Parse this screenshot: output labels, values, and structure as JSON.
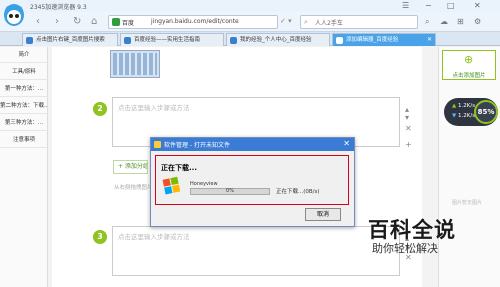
{
  "browser": {
    "app_title": "2345加速浏览器 9.3",
    "nav_back": "‹",
    "nav_forward": "›",
    "nav_reload": "↻",
    "nav_home": "⌂",
    "window_controls": [
      "☰",
      "−",
      "□",
      "✕"
    ],
    "url_site": "百度",
    "url_text": "jingyan.baidu.com/edit/conte",
    "urlbar_icons": "✓ ▾",
    "search_placeholder": "人人2手车",
    "toolbar_icons": [
      "⌕",
      "☁",
      "⊞",
      "⚙"
    ]
  },
  "tabs": [
    {
      "label": "点击图片右键_百度图片搜索",
      "active": false
    },
    {
      "label": "百度经验——实用生活指南",
      "active": false
    },
    {
      "label": "我的经验_个人中心_百度经验",
      "active": false
    },
    {
      "label": "添加编辑器_百度经验",
      "active": true
    }
  ],
  "sidebar": {
    "items": [
      "简介",
      "工具/原料",
      "第一种方法：...",
      "第二种方法：下载...",
      "第三种方法：...",
      "注意事项"
    ]
  },
  "editor": {
    "step2_number": "2",
    "step2_placeholder": "点击这里输入步骤或方法",
    "step3_number": "3",
    "step3_placeholder": "点击这里输入步骤或方法",
    "step_controls": [
      "▴",
      "▾",
      "✕",
      "+"
    ],
    "add_method": "+ 添加分组",
    "hint_line": "从右侧拖拽图片..."
  },
  "right_panel": {
    "add_image_icon": "⊕",
    "add_image_label": "点击添加图片",
    "image_hint": "图片暂无图片"
  },
  "speed_widget": {
    "upload": "1.2K/s",
    "download": "1.2K/s",
    "percent": "85%"
  },
  "dialog": {
    "title": "软件管理 - 打开未知文件",
    "close": "✕",
    "heading": "正在下载...",
    "app_name": "Honeyview",
    "progress_label": "0%",
    "progress_value": 0,
    "status": "正在下载...(0B/s)",
    "cancel": "取消"
  },
  "watermark": {
    "main": "百科全说",
    "sub": "助你轻松解决"
  },
  "colors": {
    "accent_green": "#8fc31f",
    "tab_active": "#4aa3e8",
    "dialog_titlebar": "#3a7bd5",
    "red_frame": "#d0021b"
  }
}
